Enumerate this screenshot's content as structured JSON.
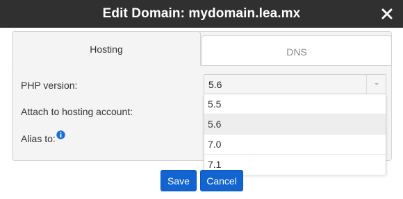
{
  "dialog": {
    "title": "Edit Domain: mydomain.lea.mx",
    "close_icon": "close-icon"
  },
  "tabs": [
    {
      "label": "Hosting",
      "active": true
    },
    {
      "label": "DNS",
      "active": false
    }
  ],
  "form": {
    "php_label": "PHP version:",
    "attach_label": "Attach to hosting account:",
    "alias_label": "Alias to:",
    "alias_info_icon": "info-icon",
    "php_select": {
      "value": "5.6",
      "options": [
        "5.5",
        "5.6",
        "7.0",
        "7.1"
      ],
      "highlighted": "5.6"
    }
  },
  "buttons": {
    "save": "Save",
    "cancel": "Cancel"
  },
  "colors": {
    "titlebar": "#303030",
    "primary_button": "#1264d0",
    "info_icon": "#1a6fd6"
  }
}
